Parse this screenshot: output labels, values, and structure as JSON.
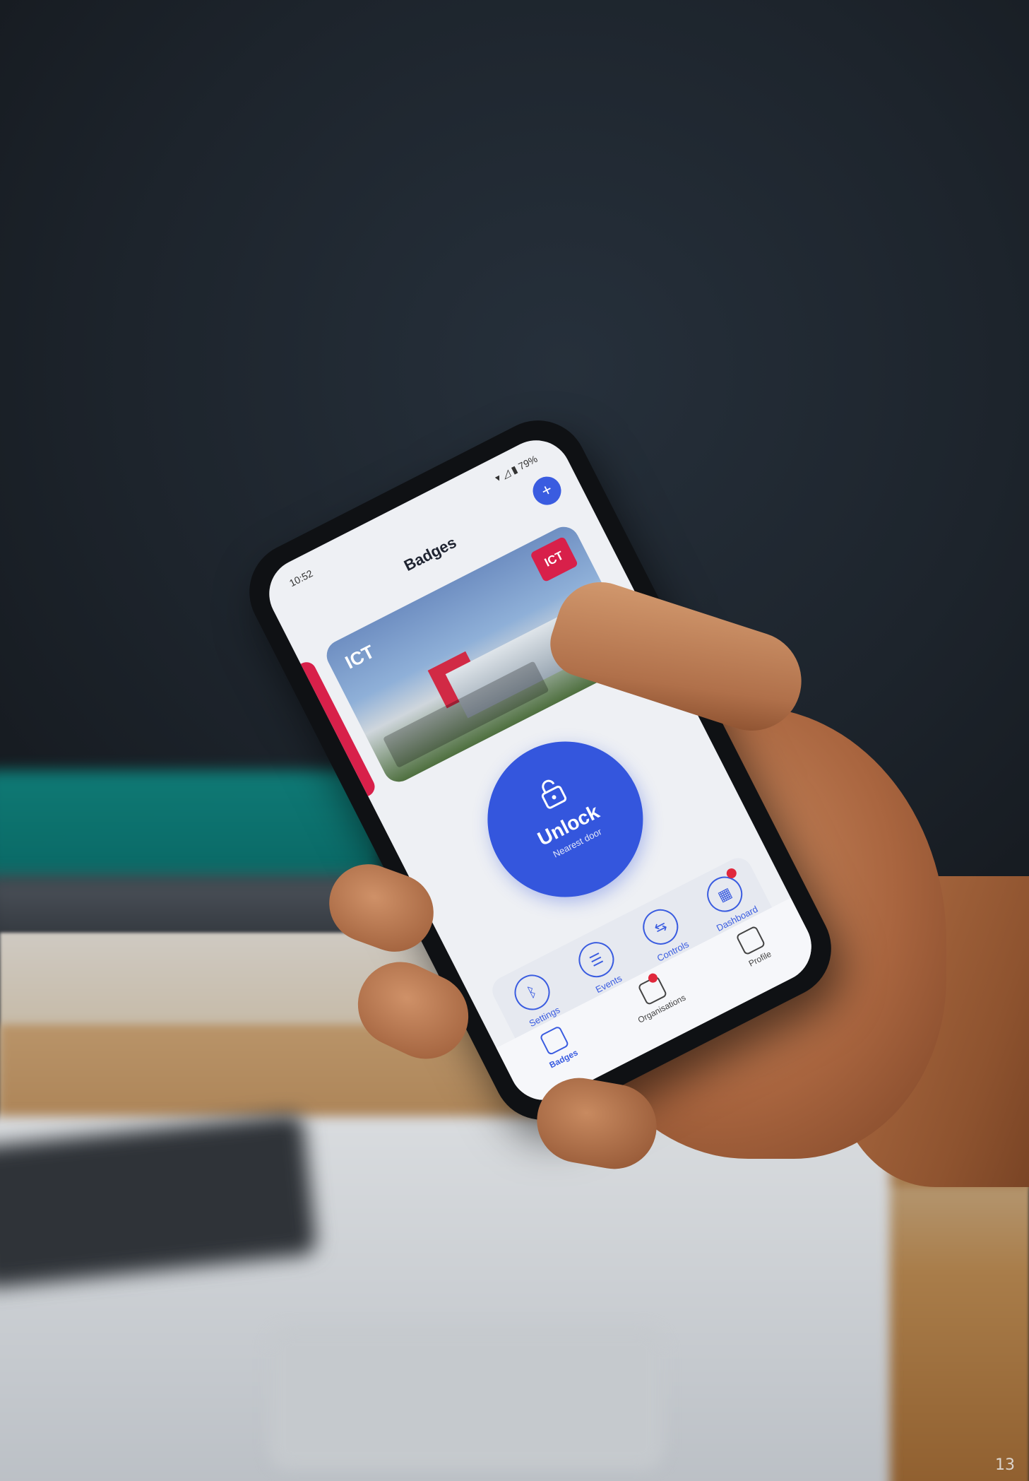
{
  "phone": {
    "status_time": "10:52",
    "status_icons": "▾ ◿ ▮ 79%",
    "title": "Badges",
    "add_button": "+",
    "badge_card": {
      "name": "ICT",
      "logo_text": "ICT"
    },
    "unlock": {
      "label": "Unlock",
      "sublabel": "Nearest door"
    },
    "actions": [
      {
        "label": "Settings",
        "icon": "bluetooth-icon"
      },
      {
        "label": "Events",
        "icon": "events-icon"
      },
      {
        "label": "Controls",
        "icon": "controls-icon"
      },
      {
        "label": "Dashboard",
        "icon": "dashboard-icon"
      }
    ],
    "nav": [
      {
        "label": "Badges",
        "icon": "badge-icon"
      },
      {
        "label": "Organisations",
        "icon": "organisations-icon"
      },
      {
        "label": "Profile",
        "icon": "profile-icon"
      }
    ],
    "accent": "#3456dd",
    "brand": "#d8204a"
  },
  "page_number": "13"
}
